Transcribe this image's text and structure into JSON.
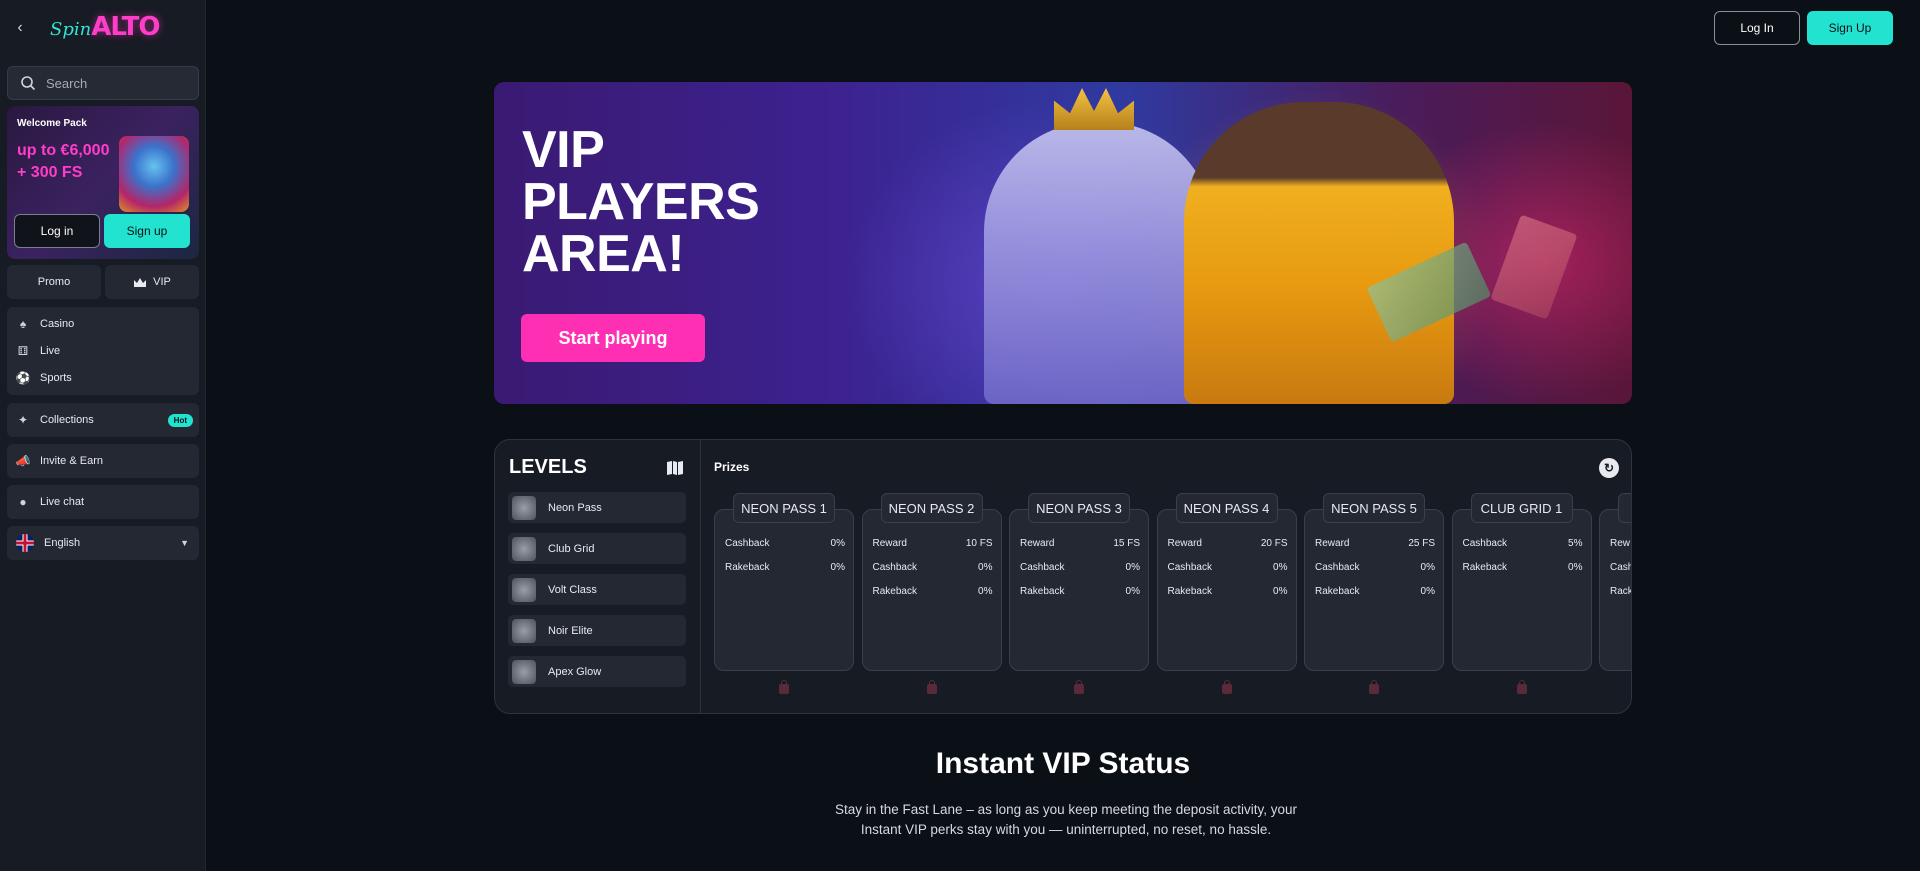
{
  "brand": {
    "spin": "Spin",
    "alto": "ALTO"
  },
  "header": {
    "login_label": "Log In",
    "signup_label": "Sign Up"
  },
  "search": {
    "placeholder": "Search"
  },
  "welcome": {
    "title": "Welcome Pack",
    "amount_line1": "up to €6,000",
    "amount_line2": "+ 300 FS",
    "login_label": "Log in",
    "signup_label": "Sign up"
  },
  "tabs": {
    "promo": "Promo",
    "vip": "VIP"
  },
  "nav": {
    "casino": "Casino",
    "live": "Live",
    "sports": "Sports",
    "collections": "Collections",
    "hot_badge": "Hot",
    "invite": "Invite & Earn",
    "live_chat": "Live chat",
    "language": "English"
  },
  "hero": {
    "title_line1": "VIP",
    "title_line2": "PLAYERS",
    "title_line3": "AREA!",
    "cta": "Start playing"
  },
  "levels": {
    "title": "LEVELS",
    "items": [
      "Neon Pass",
      "Club Grid",
      "Volt Class",
      "Noir Elite",
      "Apex Glow"
    ]
  },
  "prizes": {
    "title": "Prizes",
    "cards": [
      {
        "name": "NEON PASS 1",
        "rows": [
          [
            "Cashback",
            "0%"
          ],
          [
            "Rakeback",
            "0%"
          ]
        ]
      },
      {
        "name": "NEON PASS 2",
        "rows": [
          [
            "Reward",
            "10 FS"
          ],
          [
            "Cashback",
            "0%"
          ],
          [
            "Rakeback",
            "0%"
          ]
        ]
      },
      {
        "name": "NEON PASS 3",
        "rows": [
          [
            "Reward",
            "15 FS"
          ],
          [
            "Cashback",
            "0%"
          ],
          [
            "Rakeback",
            "0%"
          ]
        ]
      },
      {
        "name": "NEON PASS 4",
        "rows": [
          [
            "Reward",
            "20 FS"
          ],
          [
            "Cashback",
            "0%"
          ],
          [
            "Rakeback",
            "0%"
          ]
        ]
      },
      {
        "name": "NEON PASS 5",
        "rows": [
          [
            "Reward",
            "25 FS"
          ],
          [
            "Cashback",
            "0%"
          ],
          [
            "Rakeback",
            "0%"
          ]
        ]
      },
      {
        "name": "CLUB GRID 1",
        "rows": [
          [
            "Cashback",
            "5%"
          ],
          [
            "Rakeback",
            "0%"
          ]
        ]
      },
      {
        "name": "",
        "rows": [
          [
            "Rew",
            ""
          ],
          [
            "Cash",
            ""
          ],
          [
            "Rack",
            ""
          ]
        ]
      }
    ]
  },
  "instant_vip": {
    "title": "Instant VIP Status",
    "text_line1": "Stay in the Fast Lane – as long as you keep meeting the deposit activity, your",
    "text_line2": "Instant VIP perks stay with you — uninterrupted, no reset, no hassle."
  },
  "colors": {
    "accent_teal": "#22e3d0",
    "accent_pink": "#ff2fb4",
    "bg": "#0b0f16",
    "panel": "#171b24"
  }
}
